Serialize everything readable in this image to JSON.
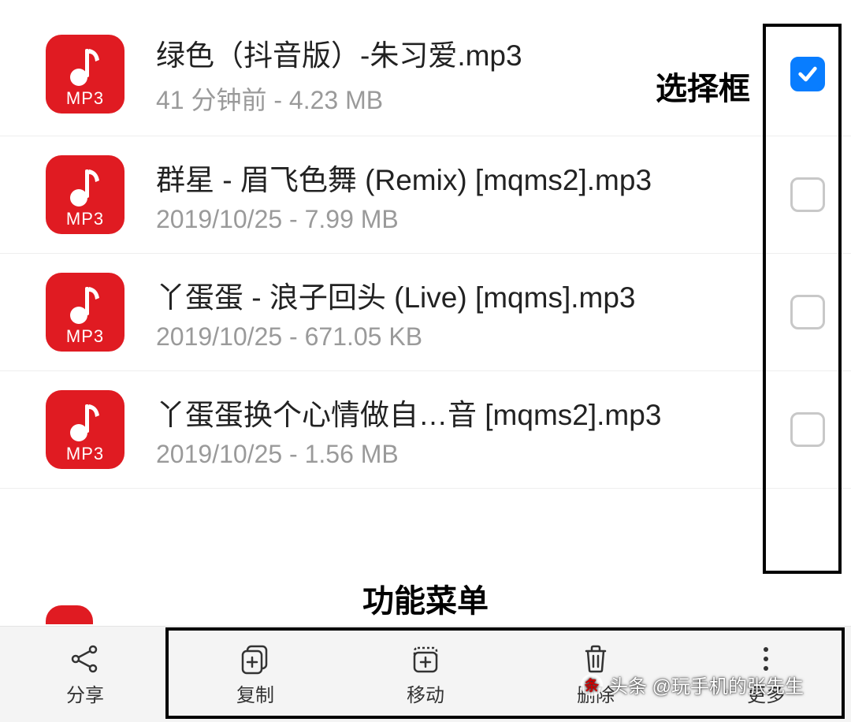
{
  "icon_ext_label": "MP3",
  "files": [
    {
      "name": "绿色（抖音版）-朱习爱.mp3",
      "meta": "41 分钟前 - 4.23 MB",
      "checked": true
    },
    {
      "name": "群星 - 眉飞色舞 (Remix) [mqms2].mp3",
      "meta": "2019/10/25 - 7.99 MB",
      "checked": false
    },
    {
      "name": "丫蛋蛋 - 浪子回头 (Live) [mqms].mp3",
      "meta": "2019/10/25 - 671.05 KB",
      "checked": false
    },
    {
      "name": "丫蛋蛋换个心情做自…音 [mqms2].mp3",
      "meta": "2019/10/25 - 1.56 MB",
      "checked": false
    }
  ],
  "annotations": {
    "selection_box_label": "选择框",
    "function_menu_label": "功能菜单"
  },
  "toolbar": {
    "share": "分享",
    "copy": "复制",
    "move": "移动",
    "delete": "删除",
    "more": "更多"
  },
  "watermark": "头条 @玩手机的张先生"
}
